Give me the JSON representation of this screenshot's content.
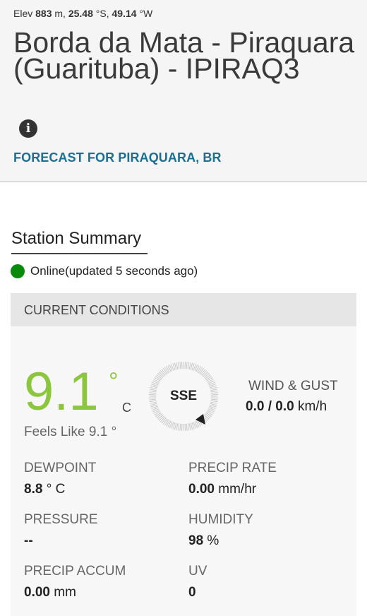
{
  "header": {
    "elev_prefix": "Elev",
    "elev_value": "883",
    "elev_unit": "m,",
    "lat_value": "25.48",
    "lat_unit": "°S,",
    "lon_value": "49.14",
    "lon_unit": "°W",
    "station_title": "Borda da Mata - Piraquara (Guarituba) - IPIRAQ3",
    "info_icon": "info-icon",
    "forecast_link": "FORECAST FOR PIRAQUARA, BR"
  },
  "summary": {
    "heading": "Station Summary",
    "status_text": "Online(updated 5 seconds ago)",
    "status_color": "#0a8a0a"
  },
  "current_conditions": {
    "header": "CURRENT CONDITIONS",
    "temperature": "9.1",
    "temp_degree": "°",
    "temp_unit": "C",
    "temp_color": "#8cc63f",
    "feels_like": "Feels Like 9.1 °",
    "compass_direction": "SSE",
    "wind_label": "WIND & GUST",
    "wind_speed": "0.0",
    "wind_separator": "/",
    "gust_speed": "0.0",
    "wind_unit": "km/h",
    "stats": {
      "dewpoint_label": "DEWPOINT",
      "dewpoint_value": "8.8",
      "dewpoint_unit": "° C",
      "precip_rate_label": "PRECIP RATE",
      "precip_rate_value": "0.00",
      "precip_rate_unit": "mm/hr",
      "pressure_label": "PRESSURE",
      "pressure_value": "--",
      "humidity_label": "HUMIDITY",
      "humidity_value": "98",
      "humidity_unit": "%",
      "precip_accum_label": "PRECIP ACCUM",
      "precip_accum_value": "0.00",
      "precip_accum_unit": "mm",
      "uv_label": "UV",
      "uv_value": "0"
    }
  }
}
